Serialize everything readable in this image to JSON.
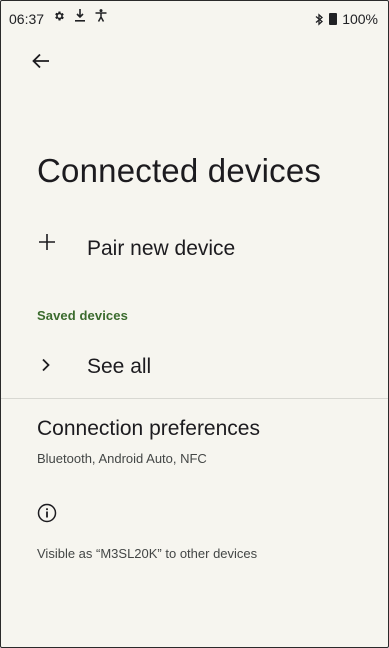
{
  "status_bar": {
    "time": "06:37",
    "battery": "100%",
    "icons_left": [
      "gear-icon",
      "download-icon",
      "accessibility-icon"
    ],
    "icons_right": [
      "bluetooth-icon",
      "battery-icon"
    ]
  },
  "header": {
    "back_icon": "arrow-back-icon"
  },
  "page": {
    "title": "Connected devices"
  },
  "items": {
    "pair_new": {
      "label": "Pair new device",
      "icon": "plus-icon"
    },
    "saved_section": "Saved devices",
    "see_all": {
      "label": "See all",
      "icon": "chevron-right-icon"
    },
    "connection_prefs": {
      "title": "Connection preferences",
      "summary": "Bluetooth, Android Auto, NFC"
    },
    "visible_as": "Visible as “M3SL20K” to other devices"
  },
  "colors": {
    "background": "#f6f5ef",
    "section_accent": "#3b6b2e",
    "text_primary": "#1c1b1f",
    "text_secondary": "#444746"
  }
}
